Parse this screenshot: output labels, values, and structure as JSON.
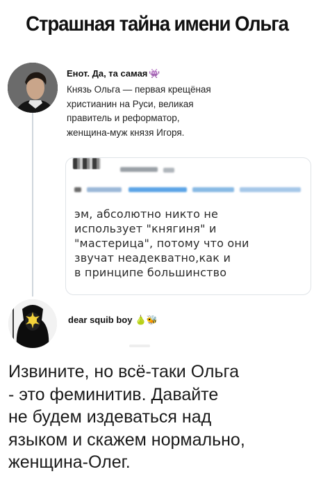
{
  "title": "Страшная тайна имени Ольга",
  "tweet1": {
    "author": "Енот. Да, та самая",
    "author_emoji": "👾",
    "text_lines": [
      "Князь Ольга — первая крещёная",
      "христианин на Руси, великая",
      "правитель и реформатор,",
      "женщина-муж князя Игоря."
    ],
    "quote": {
      "text_lines": [
        "эм, абсолютно никто не",
        "использует \"княгиня\" и",
        "\"мастерица\", потому что они",
        "звучат неадекватно,как и",
        "в принципе большинство"
      ]
    }
  },
  "tweet2": {
    "author": "dear squib boy",
    "author_emoji": "🍐🐝",
    "text_lines": [
      "Извините, но всё-таки Ольга",
      "- это феминитив. Давайте",
      "не будем издеваться над",
      "языком и скажем нормально,",
      "женщина-Олег."
    ]
  },
  "colors": {
    "thread_line": "#cfd6dc",
    "card_border": "#dfe3e7",
    "blurred_link": "#2a8fdd"
  }
}
